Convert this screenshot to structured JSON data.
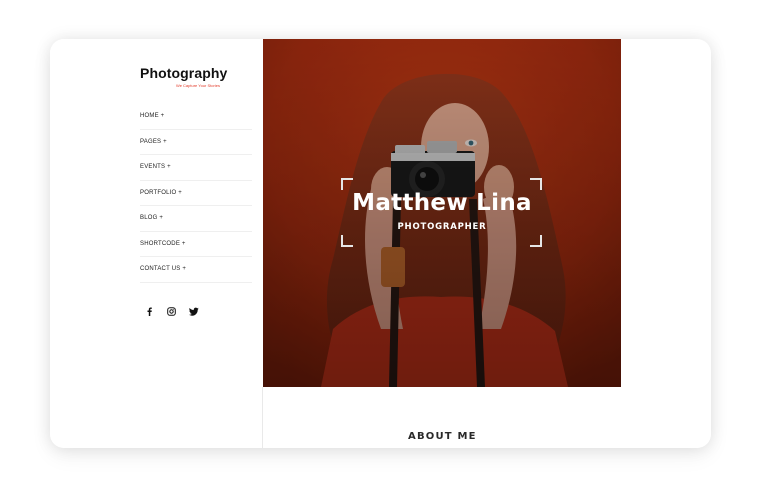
{
  "site": {
    "title": "Photography",
    "tagline": "We Capture Your Stories"
  },
  "nav": {
    "items": [
      {
        "label": "HOME +"
      },
      {
        "label": "PAGES +"
      },
      {
        "label": "EVENTS +"
      },
      {
        "label": "PORTFOLIO +"
      },
      {
        "label": "BLOG +"
      },
      {
        "label": "SHORTCODE +"
      },
      {
        "label": "CONTACT US +"
      }
    ]
  },
  "social": [
    {
      "icon": "facebook-icon"
    },
    {
      "icon": "instagram-icon"
    },
    {
      "icon": "twitter-icon"
    }
  ],
  "hero": {
    "name": "Matthew Lina",
    "role": "PHOTOGRAPHER"
  },
  "about": {
    "heading": "ABOUT ME"
  },
  "colors": {
    "accent": "#e23b2a",
    "hero_bg": "#a82f12",
    "text": "#222222"
  }
}
